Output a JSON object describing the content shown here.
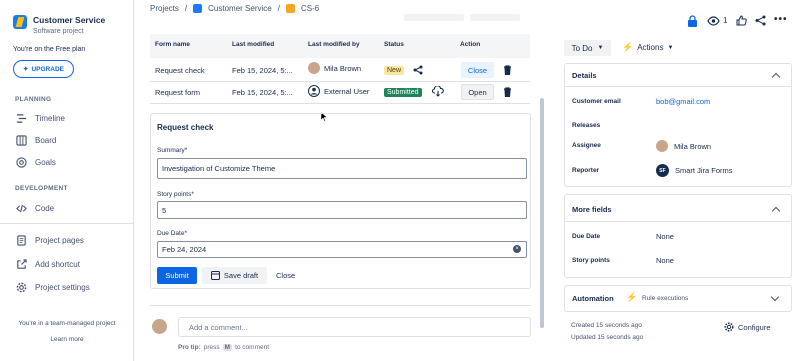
{
  "sidebar": {
    "project_name": "Customer Service",
    "project_type": "Software project",
    "plan_text": "You're on the Free plan",
    "upgrade_label": "UPGRADE",
    "planning_header": "PLANNING",
    "planning_items": [
      "Timeline",
      "Board",
      "Goals"
    ],
    "development_header": "DEVELOPMENT",
    "development_items": [
      "Code"
    ],
    "other_items": [
      "Project pages",
      "Add shortcut",
      "Project settings"
    ],
    "footer_text": "You're in a team-managed project",
    "learn_more": "Learn more"
  },
  "breadcrumb": {
    "projects": "Projects",
    "separator": "/",
    "project": "Customer Service",
    "issue": "CS-6"
  },
  "forms_table": {
    "headers": [
      "Form name",
      "Last modified",
      "Last modified by",
      "Status",
      "Action"
    ],
    "rows": [
      {
        "name": "Request check",
        "modified": "Feb 15, 2024, 5:...",
        "by": "Mila Brown",
        "status": "New",
        "action": "Close"
      },
      {
        "name": "Request form",
        "modified": "Feb 15, 2024, 5:...",
        "by": "External User",
        "status": "Submitted",
        "action": "Open"
      }
    ]
  },
  "form": {
    "title": "Request check",
    "summary_label": "Summary*",
    "summary_value": "Investigation of Customize Theme",
    "story_label": "Story points*",
    "story_value": "5",
    "due_label": "Due Date*",
    "due_value": "Feb 24, 2024",
    "submit": "Submit",
    "save_draft": "Save draft",
    "close": "Close"
  },
  "comment": {
    "placeholder": "Add a comment...",
    "protip_bold": "Pro tip:",
    "protip_pre": "press",
    "protip_key": "M",
    "protip_post": "to comment"
  },
  "right": {
    "watch_count": "1",
    "status": "To Do",
    "actions": "Actions",
    "details_header": "Details",
    "customer_email_label": "Customer email",
    "customer_email_value": "bob@gmail.com",
    "releases_label": "Releases",
    "assignee_label": "Assignee",
    "assignee_value": "Mila Brown",
    "reporter_label": "Reporter",
    "reporter_initials": "SF",
    "reporter_value": "Smart Jira Forms",
    "more_fields_header": "More fields",
    "due_date_label": "Due Date",
    "due_date_value": "None",
    "story_points_label": "Story points",
    "story_points_value": "None",
    "automation_header": "Automation",
    "rule_executions": "Rule executions",
    "created": "Created 15 seconds ago",
    "updated": "Updated 15 seconds ago",
    "configure": "Configure"
  },
  "colors": {
    "primary": "#0C66E4",
    "submitted": "#1F845A",
    "new_badge": "#F8E6A0"
  }
}
